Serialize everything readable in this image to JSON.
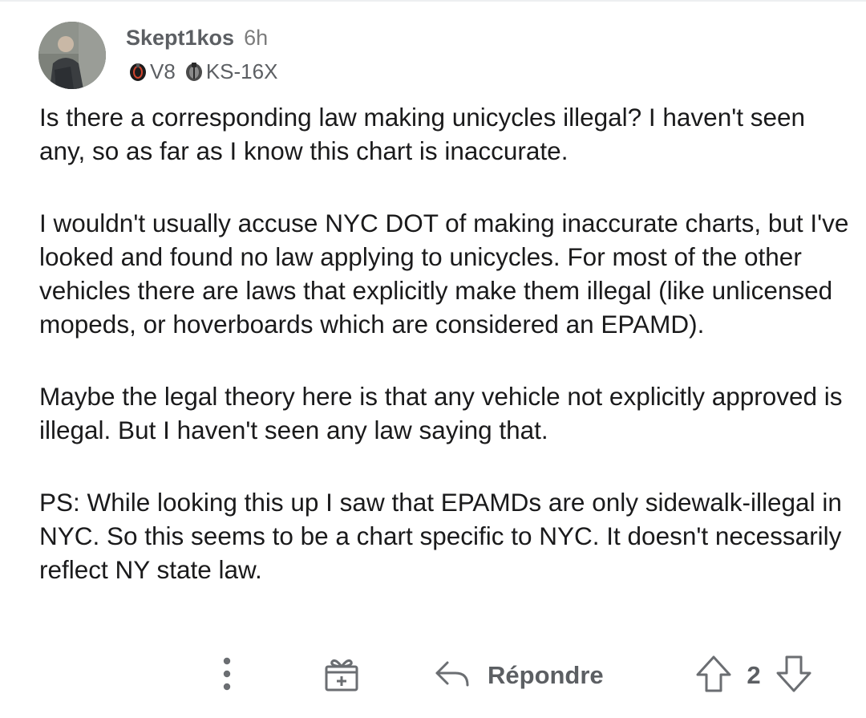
{
  "comment": {
    "author": "Skept1kos",
    "age": "6h",
    "flairs": [
      {
        "icon": "v8-wheel-icon",
        "label": "V8"
      },
      {
        "icon": "ks16x-wheel-icon",
        "label": "KS-16X"
      }
    ],
    "paragraphs": [
      "Is there a corresponding law making unicycles illegal? I haven't seen any, so as far as I know this chart is inaccurate.",
      "I wouldn't usually accuse NYC DOT of making inaccurate charts, but I've looked and found no law applying to unicycles. For most of the other vehicles there are laws that explicitly make them illegal (like unlicensed mopeds, or hoverboards which are considered an EPAMD).",
      "Maybe the legal theory here is that any vehicle not explicitly approved is illegal. But I haven't seen any law saying that.",
      "PS: While looking this up I saw that EPAMDs are only sidewalk-illegal in NYC. So this seems to be a chart specific to NYC. It doesn't necessarily reflect NY state law."
    ]
  },
  "actions": {
    "more_icon": "more-vertical-icon",
    "award_icon": "award-gift-icon",
    "reply_icon": "reply-arrow-icon",
    "reply_label": "Répondre",
    "upvote_icon": "upvote-arrow-icon",
    "score": "2",
    "downvote_icon": "downvote-arrow-icon"
  },
  "colors": {
    "text": "#1a1a1b",
    "meta": "#5c5f63",
    "icon": "#6b6e72",
    "background": "#ffffff"
  }
}
